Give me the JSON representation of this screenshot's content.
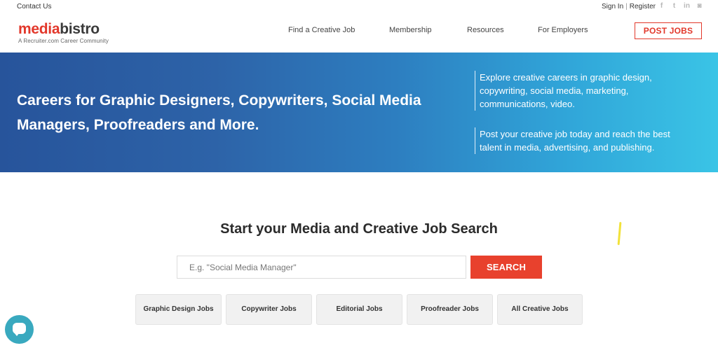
{
  "utility": {
    "contact_label": "Contact Us",
    "sign_in_label": "Sign In",
    "separator": "|",
    "register_label": "Register",
    "social": [
      {
        "icon": "facebook-icon",
        "glyph": "f"
      },
      {
        "icon": "twitter-icon",
        "glyph": "t"
      },
      {
        "icon": "linkedin-icon",
        "glyph": "in"
      },
      {
        "icon": "instagram-icon",
        "glyph": "◙"
      }
    ]
  },
  "header": {
    "logo_red": "media",
    "logo_dark": "bistro",
    "logo_tagline": "A Recruiter.com Career Community",
    "nav": [
      {
        "label": "Find a Creative Job"
      },
      {
        "label": "Membership"
      },
      {
        "label": "Resources"
      },
      {
        "label": "For Employers"
      }
    ],
    "post_jobs_label": "POST JOBS"
  },
  "hero": {
    "title": "Careers for Graphic Designers, Copywriters, Social Media Managers, Proofreaders and More.",
    "blurb_1": "Explore creative careers in graphic design, copywriting, social media, marketing, communications, video.",
    "blurb_2": "Post your creative job today and reach the best talent in media, advertising, and publishing."
  },
  "search": {
    "title": "Start your Media and Creative Job Search",
    "placeholder": "E.g. \"Social Media Manager\"",
    "value": "",
    "button_label": "SEARCH",
    "categories": [
      {
        "label": "Graphic Design Jobs"
      },
      {
        "label": "Copywriter Jobs"
      },
      {
        "label": "Editorial Jobs"
      },
      {
        "label": "Proofreader Jobs"
      },
      {
        "label": "All Creative Jobs"
      }
    ]
  },
  "colors": {
    "brand_red": "#e2382b",
    "search_button": "#e8412d",
    "hero_start": "#27549b",
    "hero_end": "#3ac4e6",
    "chat_bubble": "#39a9bf"
  }
}
